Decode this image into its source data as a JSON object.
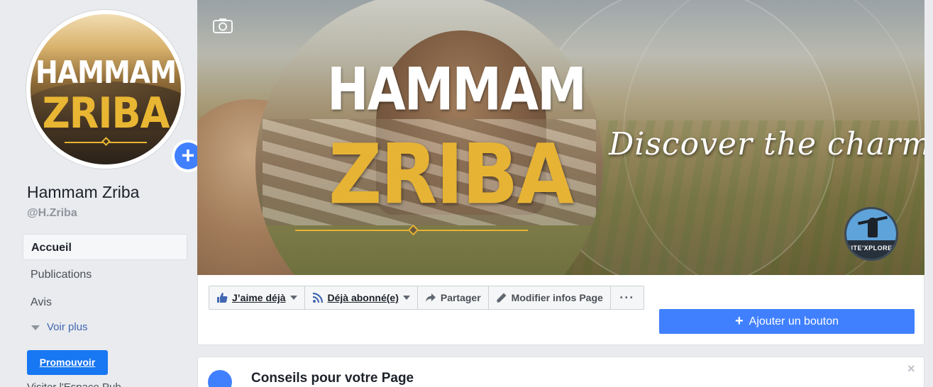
{
  "sidebar": {
    "avatar": {
      "line1": "HAMMAM",
      "line2": "ZRIBA"
    },
    "page_name": "Hammam Zriba",
    "handle": "@H.Zriba",
    "nav": [
      {
        "label": "Accueil",
        "active": true
      },
      {
        "label": "Publications",
        "active": false
      },
      {
        "label": "Avis",
        "active": false
      }
    ],
    "voir_plus": "Voir plus",
    "promote": "Promouvoir",
    "cut_text": "Visiter l'Espace Pub"
  },
  "cover": {
    "title_line1": "HAMMAM",
    "title_line2": "ZRIBA",
    "tagline": "Discover the charm...",
    "badge_text": "SITE'XPLORERS"
  },
  "actions": {
    "like": "J’aime déjà",
    "subscribed": "Déjà abonné(e)",
    "share": "Partager",
    "edit": "Modifier infos Page",
    "more": "···",
    "add_button": "Ajouter un bouton"
  },
  "tips": {
    "title": "Conseils pour votre Page",
    "close": "×"
  },
  "colors": {
    "primary_blue": "#4080ff",
    "promote_blue": "#1877f2",
    "link_blue": "#4267b2",
    "gold": "#e7b334"
  }
}
